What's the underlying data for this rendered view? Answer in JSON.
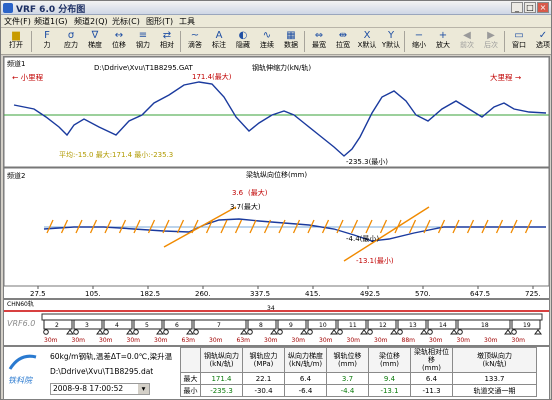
{
  "window": {
    "title": "VRF 6.0 分布图",
    "minimize": "_",
    "maximize": "□",
    "close": "×"
  },
  "menu": [
    "文件(F)",
    "频道1(G)",
    "频道2(Q)",
    "光标(C)",
    "图形(T)",
    "工具"
  ],
  "toolbar": {
    "open": "打开",
    "buttons": [
      {
        "label": "力",
        "icon": "force-icon"
      },
      {
        "label": "应力",
        "icon": "stress-icon"
      },
      {
        "label": "梯度",
        "icon": "gradient-icon"
      },
      {
        "label": "位移",
        "icon": "displacement-icon"
      },
      {
        "label": "钢力",
        "icon": "rail-force-icon"
      },
      {
        "label": "相对",
        "icon": "relative-icon"
      },
      {
        "label": "滴答",
        "icon": "tick-icon"
      },
      {
        "label": "标注",
        "icon": "annotate-icon"
      },
      {
        "label": "隐藏",
        "icon": "hide-icon"
      },
      {
        "label": "连续",
        "icon": "continuous-icon"
      },
      {
        "label": "数据",
        "icon": "data-icon"
      },
      {
        "label": "最宽",
        "icon": "widest-icon"
      },
      {
        "label": "拉宽",
        "icon": "stretch-icon"
      },
      {
        "label": "X默认",
        "icon": "x-default-icon"
      },
      {
        "label": "Y默认",
        "icon": "y-default-icon"
      },
      {
        "label": "缩小",
        "icon": "zoom-out-icon"
      },
      {
        "label": "放大",
        "icon": "zoom-in-icon"
      },
      {
        "label": "前次",
        "icon": "previous-icon"
      },
      {
        "label": "后次",
        "icon": "next-icon"
      },
      {
        "label": "窗口",
        "icon": "window-icon"
      },
      {
        "label": "选项",
        "icon": "options-icon"
      }
    ]
  },
  "channel1": {
    "name": "频道1",
    "file": "D:\\Ddrive\\Xvu\\T1B8295.GAT",
    "title": "钢轨伸缩力(kN/轨)",
    "left_tag": "小里程",
    "right_tag": "大里程",
    "max_label": "171.4(最大)",
    "min_label": "-235.3(最小)",
    "summary": "平均:-15.0 最大:171.4 最小:-235.3"
  },
  "channel2": {
    "name": "频道2",
    "title": "梁轨纵向位移(mm)",
    "max_label1": "最大",
    "max_value1": "3.6",
    "max_value2": "3.7(最大)",
    "min_label1": "-4.4(最小)",
    "min_label2": "-13.1(最小)"
  },
  "x_ticks": [
    "27.5",
    "105.",
    "182.5",
    "260.",
    "337.5",
    "415.",
    "492.5",
    "570.",
    "647.5",
    "725."
  ],
  "track": {
    "rail_label": "CHN60轨",
    "top_label": "34",
    "spans": [
      "2",
      "3",
      "4",
      "5",
      "6",
      "7",
      "8",
      "9",
      "10",
      "11",
      "12",
      "13",
      "14",
      "18",
      "19"
    ],
    "span_lengths": [
      "30m",
      "30m",
      "30m",
      "30m",
      "30m",
      "63m",
      "30m",
      "63m",
      "30m",
      "30m",
      "30m",
      "30m",
      "30m",
      "88m",
      "30m",
      "30m",
      "30m",
      "30m"
    ],
    "logo": "VRF6.0"
  },
  "info": {
    "line1": "60kg/m钢轨,温差ΔT=0.0℃,梁升温",
    "line2": "D:\\Ddrive\\Xvu\\T1B8295.dat",
    "line3": "2008-9-8 17:00:52",
    "brand": "铁科院",
    "headers": [
      "钢轨纵向力\n(kN/轨)",
      "钢轨应力\n(MPa)",
      "纵向力梯度\n(kN/轨/m)",
      "钢轨位移\n(mm)",
      "梁位移\n(mm)",
      "梁轨相对位移\n(mm)",
      "墩顶纵向力\n(kN/轨)"
    ],
    "rows": [
      {
        "label": "最大",
        "values": [
          "171.4",
          "22.1",
          "6.4",
          "3.7",
          "9.4",
          "6.4",
          "133.7"
        ]
      },
      {
        "label": "最小",
        "values": [
          "-235.3",
          "-30.4",
          "-6.4",
          "-4.4",
          "-13.1",
          "-11.3",
          "轨道交通一期"
        ]
      }
    ]
  },
  "colors": {
    "curve": "#1a3a9e",
    "marker": "#f08a00",
    "label_red": "#c00000",
    "grid_green": "#3aa03a"
  }
}
